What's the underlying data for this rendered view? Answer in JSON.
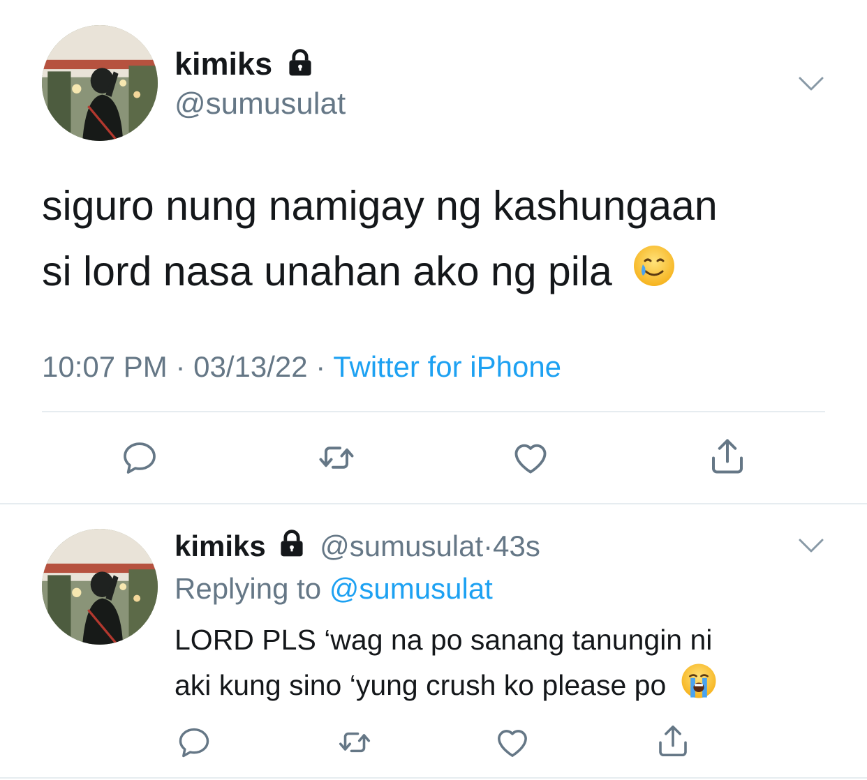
{
  "main_tweet": {
    "display_name": "kimiks",
    "handle": "@sumusulat",
    "text_line1": "siguro nung namigay ng kashungaan",
    "text_line2": "si lord nasa unahan ako ng pila",
    "time": "10:07 PM",
    "date": "03/13/22",
    "separator": "·",
    "source": "Twitter for iPhone"
  },
  "reply_tweet": {
    "display_name": "kimiks",
    "handle": "@sumusulat",
    "separator": "·",
    "age": "43s",
    "replying_prefix": "Replying to",
    "replying_to": "@sumusulat",
    "text_line1": "LORD PLS ‘wag na po sanang tanungin ni",
    "text_line2": "aki kung sino ‘yung crush ko please po"
  },
  "icons": {
    "lock": "lock-icon",
    "chevron": "chevron-down-icon",
    "reply": "reply-icon",
    "retweet": "retweet-icon",
    "like": "heart-icon",
    "share": "share-icon",
    "emoji_main": "smiling-face-with-tear-emoji",
    "emoji_reply": "loudly-crying-face-emoji"
  },
  "colors": {
    "text": "#14171a",
    "secondary": "#657786",
    "link": "#1da1f2",
    "divider": "#e6ecf0",
    "icon": "#657786"
  }
}
